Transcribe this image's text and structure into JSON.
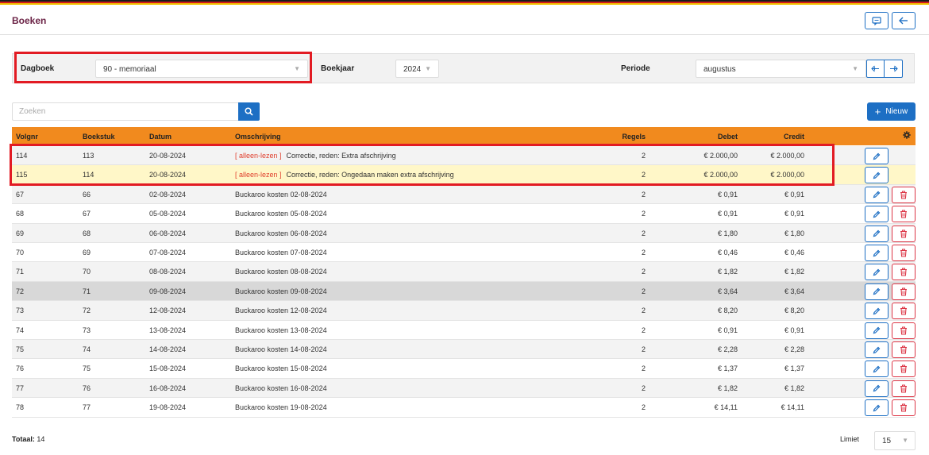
{
  "colors": {
    "accent": "#1d6fc4",
    "header_orange": "#f18a1e",
    "title": "#6b2346",
    "highlight_red": "#e21b23",
    "readonly_red": "#e0402e",
    "flag": [
      "#1a1a1a",
      "#d21c1c",
      "#f2c200"
    ]
  },
  "header": {
    "title": "Boeken",
    "icons": [
      "comment-icon",
      "arrow-left-icon"
    ]
  },
  "filters": {
    "dagboek_label": "Dagboek",
    "dagboek_value": "90 - memoriaal",
    "boekjaar_label": "Boekjaar",
    "boekjaar_value": "2024",
    "periode_label": "Periode",
    "periode_value": "augustus",
    "prev_icon": "prev-period-icon",
    "next_icon": "next-period-icon"
  },
  "search": {
    "placeholder": "Zoeken",
    "icon": "search-icon"
  },
  "toolbar": {
    "new_label": "Nieuw",
    "new_icon": "plus-icon"
  },
  "table": {
    "columns": {
      "volgnr": "Volgnr",
      "boekstuk": "Boekstuk",
      "datum": "Datum",
      "omschrijving": "Omschrijving",
      "regels": "Regels",
      "debet": "Debet",
      "credit": "Credit"
    },
    "settings_icon": "gear-icon",
    "readonly_tag": "[ alleen-lezen ]",
    "rows": [
      {
        "volgnr": "114",
        "boekstuk": "113",
        "datum": "20-08-2024",
        "readonly": true,
        "omschrijving": "Correctie, reden: Extra afschrijving",
        "regels": "2",
        "debet": "€ 2.000,00",
        "credit": "€ 2.000,00",
        "deletable": false
      },
      {
        "volgnr": "115",
        "boekstuk": "114",
        "datum": "20-08-2024",
        "readonly": true,
        "omschrijving": "Correctie, reden: Ongedaan maken extra afschrijving",
        "regels": "2",
        "debet": "€ 2.000,00",
        "credit": "€ 2.000,00",
        "deletable": false
      },
      {
        "volgnr": "67",
        "boekstuk": "66",
        "datum": "02-08-2024",
        "readonly": false,
        "omschrijving": "Buckaroo kosten 02-08-2024",
        "regels": "2",
        "debet": "€ 0,91",
        "credit": "€ 0,91",
        "deletable": true
      },
      {
        "volgnr": "68",
        "boekstuk": "67",
        "datum": "05-08-2024",
        "readonly": false,
        "omschrijving": "Buckaroo kosten 05-08-2024",
        "regels": "2",
        "debet": "€ 0,91",
        "credit": "€ 0,91",
        "deletable": true
      },
      {
        "volgnr": "69",
        "boekstuk": "68",
        "datum": "06-08-2024",
        "readonly": false,
        "omschrijving": "Buckaroo kosten 06-08-2024",
        "regels": "2",
        "debet": "€ 1,80",
        "credit": "€ 1,80",
        "deletable": true
      },
      {
        "volgnr": "70",
        "boekstuk": "69",
        "datum": "07-08-2024",
        "readonly": false,
        "omschrijving": "Buckaroo kosten 07-08-2024",
        "regels": "2",
        "debet": "€ 0,46",
        "credit": "€ 0,46",
        "deletable": true
      },
      {
        "volgnr": "71",
        "boekstuk": "70",
        "datum": "08-08-2024",
        "readonly": false,
        "omschrijving": "Buckaroo kosten 08-08-2024",
        "regels": "2",
        "debet": "€ 1,82",
        "credit": "€ 1,82",
        "deletable": true
      },
      {
        "volgnr": "72",
        "boekstuk": "71",
        "datum": "09-08-2024",
        "readonly": false,
        "omschrijving": "Buckaroo kosten 09-08-2024",
        "regels": "2",
        "debet": "€ 3,64",
        "credit": "€ 3,64",
        "deletable": true
      },
      {
        "volgnr": "73",
        "boekstuk": "72",
        "datum": "12-08-2024",
        "readonly": false,
        "omschrijving": "Buckaroo kosten 12-08-2024",
        "regels": "2",
        "debet": "€ 8,20",
        "credit": "€ 8,20",
        "deletable": true
      },
      {
        "volgnr": "74",
        "boekstuk": "73",
        "datum": "13-08-2024",
        "readonly": false,
        "omschrijving": "Buckaroo kosten 13-08-2024",
        "regels": "2",
        "debet": "€ 0,91",
        "credit": "€ 0,91",
        "deletable": true
      },
      {
        "volgnr": "75",
        "boekstuk": "74",
        "datum": "14-08-2024",
        "readonly": false,
        "omschrijving": "Buckaroo kosten 14-08-2024",
        "regels": "2",
        "debet": "€ 2,28",
        "credit": "€ 2,28",
        "deletable": true
      },
      {
        "volgnr": "76",
        "boekstuk": "75",
        "datum": "15-08-2024",
        "readonly": false,
        "omschrijving": "Buckaroo kosten 15-08-2024",
        "regels": "2",
        "debet": "€ 1,37",
        "credit": "€ 1,37",
        "deletable": true
      },
      {
        "volgnr": "77",
        "boekstuk": "76",
        "datum": "16-08-2024",
        "readonly": false,
        "omschrijving": "Buckaroo kosten 16-08-2024",
        "regels": "2",
        "debet": "€ 1,82",
        "credit": "€ 1,82",
        "deletable": true
      },
      {
        "volgnr": "78",
        "boekstuk": "77",
        "datum": "19-08-2024",
        "readonly": false,
        "omschrijving": "Buckaroo kosten 19-08-2024",
        "regels": "2",
        "debet": "€ 14,11",
        "credit": "€ 14,11",
        "deletable": true
      }
    ]
  },
  "footer": {
    "total_label": "Totaal:",
    "total_value": "14",
    "limiet_label": "Limiet",
    "limiet_value": "15"
  }
}
